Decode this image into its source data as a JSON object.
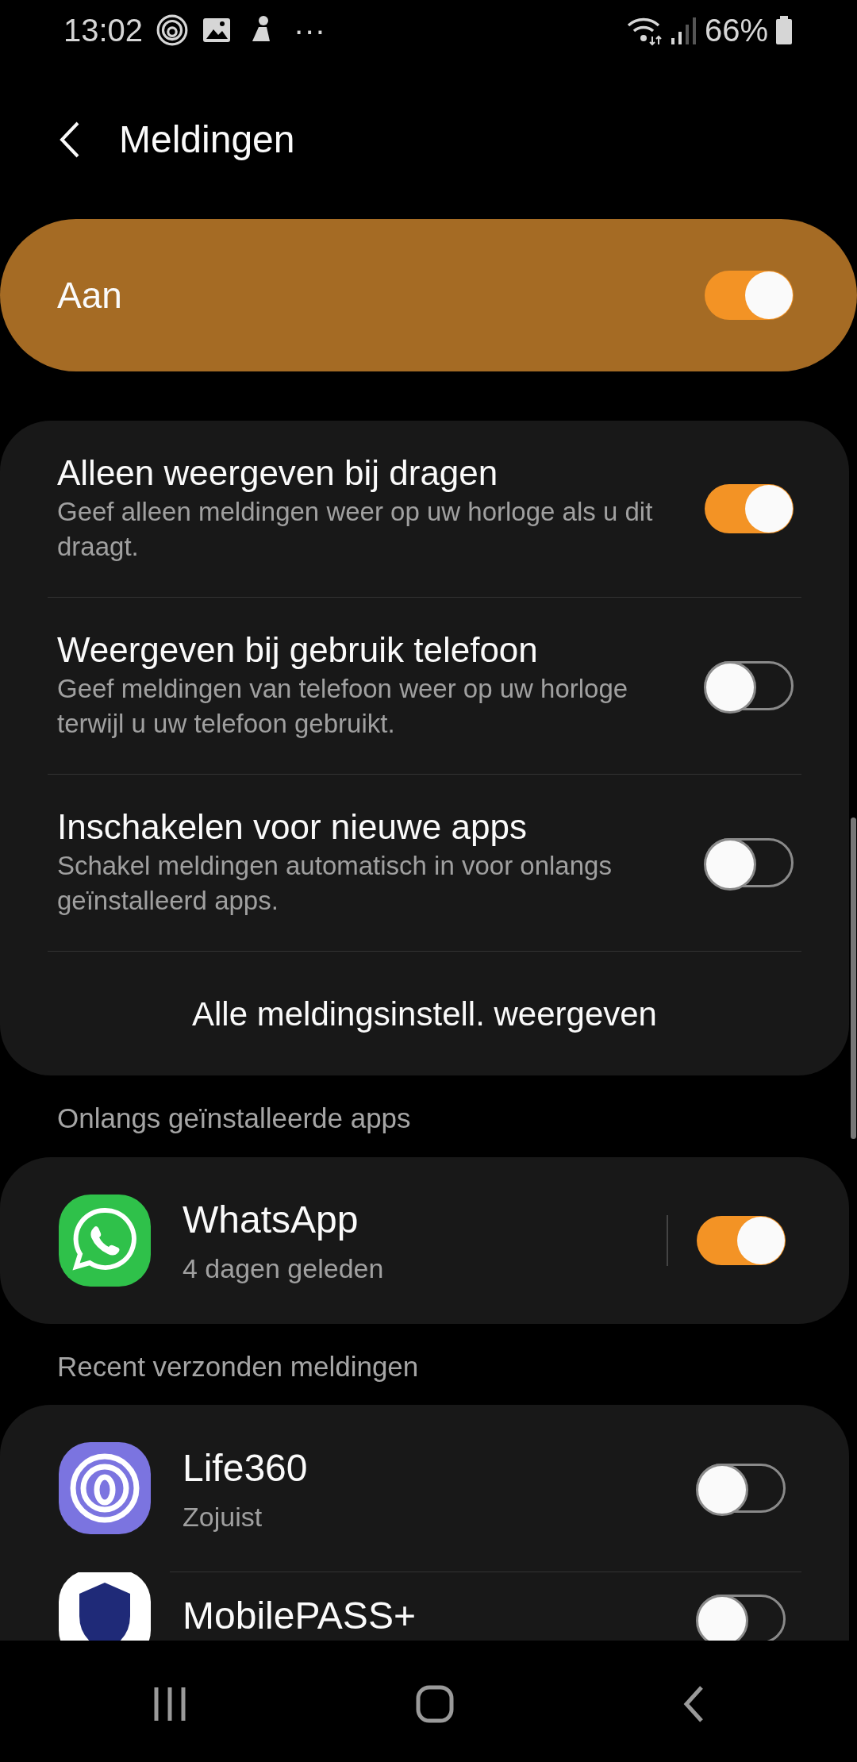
{
  "status_bar": {
    "time": "13:02",
    "more": "···",
    "battery": "66%"
  },
  "header": {
    "title": "Meldingen"
  },
  "master": {
    "label": "Aan",
    "on": true
  },
  "settings": [
    {
      "title": "Alleen weergeven bij dragen",
      "subtitle": "Geef alleen meldingen weer op uw horloge als u dit draagt.",
      "on": true
    },
    {
      "title": "Weergeven bij gebruik telefoon",
      "subtitle": "Geef meldingen van telefoon weer op uw horloge terwijl u uw telefoon gebruikt.",
      "on": false
    },
    {
      "title": "Inschakelen voor nieuwe apps",
      "subtitle": "Schakel meldingen automatisch in voor onlangs geïnstalleerd apps.",
      "on": false
    }
  ],
  "settings_action": "Alle meldingsinstell. weergeven",
  "sections": [
    {
      "header": "Onlangs geïnstalleerde apps",
      "kind": "installed",
      "apps": [
        {
          "name": "WhatsApp",
          "time": "4 dagen geleden",
          "on": true
        }
      ]
    },
    {
      "header": "Recent verzonden meldingen",
      "kind": "sent",
      "apps": [
        {
          "name": "Life360",
          "time": "Zojuist",
          "on": false
        },
        {
          "name": "MobilePASS+",
          "on": false
        }
      ]
    }
  ]
}
